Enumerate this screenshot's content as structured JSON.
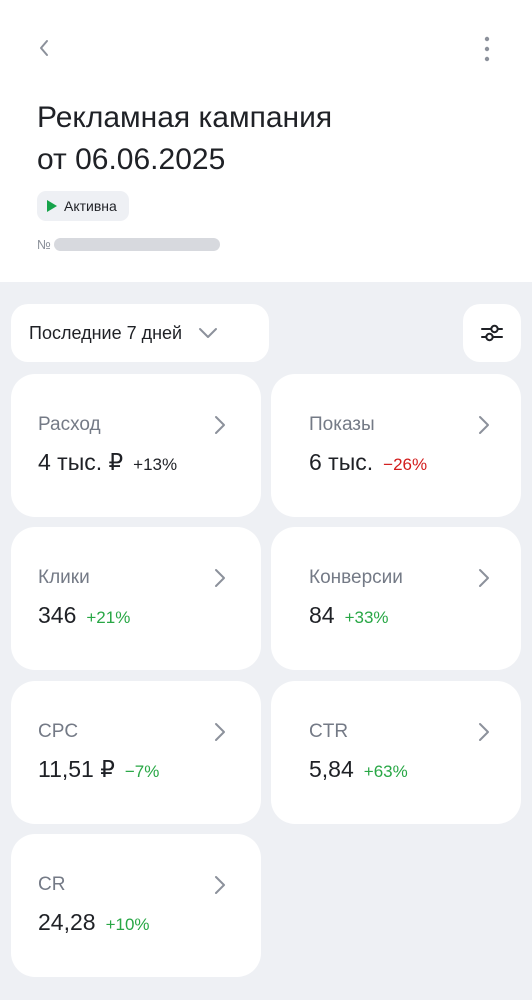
{
  "header": {
    "title_line1": "Рекламная кампания",
    "title_line2": "от 06.06.2025",
    "status": "Активна",
    "number_prefix": "№"
  },
  "filters": {
    "period_label": "Последние 7 дней"
  },
  "metrics": [
    {
      "label": "Расход",
      "value": "4 тыс. ₽",
      "delta": "+13%",
      "trend": "neutral"
    },
    {
      "label": "Показы",
      "value": "6 тыс.",
      "delta": "−26%",
      "trend": "down"
    },
    {
      "label": "Клики",
      "value": "346",
      "delta": "+21%",
      "trend": "up"
    },
    {
      "label": "Конверсии",
      "value": "84",
      "delta": "+33%",
      "trend": "up"
    },
    {
      "label": "CPC",
      "value": "11,51 ₽",
      "delta": "−7%",
      "trend": "up"
    },
    {
      "label": "CTR",
      "value": "5,84",
      "delta": "+63%",
      "trend": "up"
    },
    {
      "label": "CR",
      "value": "24,28",
      "delta": "+10%",
      "trend": "up"
    }
  ],
  "colors": {
    "status_green": "#16a34a",
    "delta_up": "#28a745",
    "delta_down": "#d21c1c",
    "page_background": "#eef0f4"
  },
  "icons": {
    "back": "chevron-left-icon",
    "more": "more-vertical-icon",
    "status": "play-icon",
    "period": "chevron-down-icon",
    "filter": "sliders-icon",
    "card": "chevron-right-icon"
  }
}
